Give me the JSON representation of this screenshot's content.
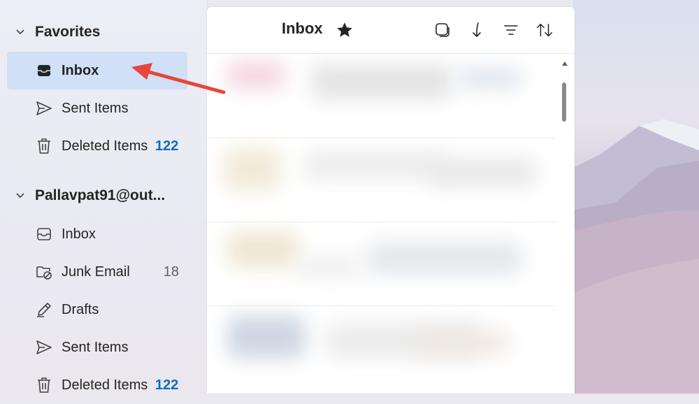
{
  "sidebar": {
    "favorites": {
      "header": "Favorites",
      "items": [
        {
          "label": "Inbox",
          "icon": "inbox-filled-icon",
          "selected": true
        },
        {
          "label": "Sent Items",
          "icon": "send-icon"
        },
        {
          "label": "Deleted Items",
          "icon": "trash-icon",
          "count": "122"
        }
      ]
    },
    "account": {
      "header": "Pallavpat91@out...",
      "items": [
        {
          "label": "Inbox",
          "icon": "inbox-icon"
        },
        {
          "label": "Junk Email",
          "icon": "junk-folder-icon",
          "count": "18"
        },
        {
          "label": "Drafts",
          "icon": "drafts-pencil-icon"
        },
        {
          "label": "Sent Items",
          "icon": "send-icon"
        },
        {
          "label": "Deleted Items",
          "icon": "trash-icon",
          "count": "122"
        }
      ]
    }
  },
  "panel": {
    "title": "Inbox",
    "toolbar": [
      "select-icon",
      "jump-to-icon",
      "filter-icon",
      "sort-icon"
    ]
  },
  "colors": {
    "accent": "#0f6cbd",
    "selection": "#cfe0f7",
    "annotation_arrow": "#e8453c"
  }
}
